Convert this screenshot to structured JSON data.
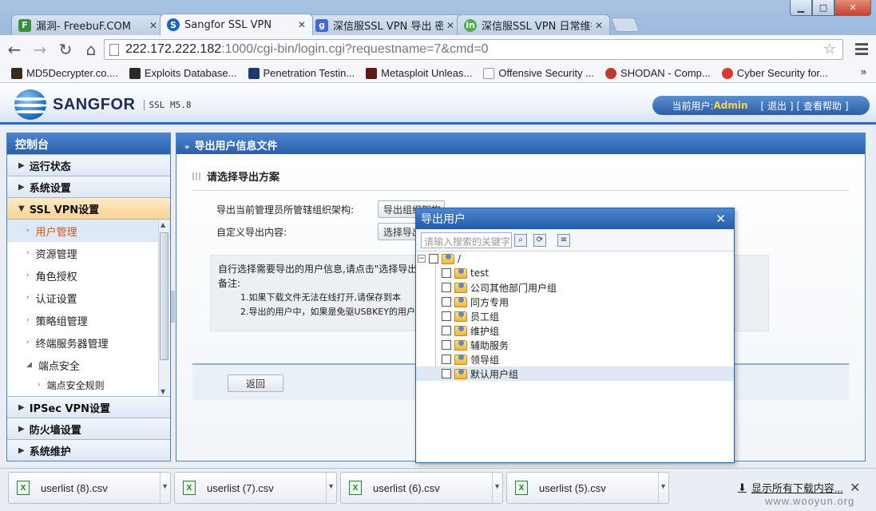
{
  "browser": {
    "tabs": [
      {
        "label": "漏洞- FreebuF.COM",
        "icon": "freebuf-icon",
        "color": "#3a8f3a",
        "glyph": "F"
      },
      {
        "label": "Sangfor SSL VPN",
        "icon": "sangfor-icon",
        "color": "#1a66b8",
        "glyph": "S"
      },
      {
        "label": "深信服SSL VPN 导出 密码",
        "icon": "google-icon",
        "color": "#3d6bd3",
        "glyph": "g"
      },
      {
        "label": "深信服SSL VPN 日常维护",
        "icon": "site-icon",
        "color": "#4caf50",
        "glyph": "in"
      }
    ],
    "url_host": "222.172.222.182",
    "url_rest": ":1000/cgi-bin/login.cgi?requestname=7&cmd=0",
    "bookmarks": [
      {
        "label": "MD5Decrypter.co....",
        "color": "#3b2a1a"
      },
      {
        "label": "Exploits Database...",
        "color": "#2a2a2a"
      },
      {
        "label": "Penetration Testin...",
        "color": "#1b3a6e"
      },
      {
        "label": "Metasploit Unleas...",
        "color": "#5a1a1a"
      },
      {
        "label": "Offensive Security ...",
        "color": "#dddddd"
      },
      {
        "label": "SHODAN - Comp...",
        "color": "#c0392b"
      },
      {
        "label": "Cyber Security for...",
        "color": "#d63b2f"
      }
    ],
    "bookmarks_more": "»"
  },
  "header": {
    "brand": "SANGFOR",
    "version": "SSL M5.8",
    "current_user_label": "当前用户:",
    "current_user": "Admin",
    "logout": "[ 退出 ]",
    "help": "[ 查看帮助 ]"
  },
  "sidebar": {
    "title": "控制台",
    "groups_top": [
      {
        "label": "运行状态"
      },
      {
        "label": "系统设置"
      }
    ],
    "open_group": "SSL VPN设置",
    "items": [
      {
        "label": "用户管理",
        "active": true
      },
      {
        "label": "资源管理"
      },
      {
        "label": "角色授权"
      },
      {
        "label": "认证设置"
      },
      {
        "label": "策略组管理"
      },
      {
        "label": "终端服务器管理"
      },
      {
        "label": "端点安全",
        "expanded": true
      }
    ],
    "child_items": [
      {
        "label": "端点安全规则"
      }
    ],
    "groups_bottom": [
      {
        "label": "IPSec VPN设置"
      },
      {
        "label": "防火墙设置"
      },
      {
        "label": "系统维护"
      }
    ]
  },
  "main": {
    "title": "导出用户信息文件",
    "section": "请选择导出方案",
    "row1_label": "导出当前管理员所管辖组织架构:",
    "row1_button": "导出组织架构",
    "row2_label": "自定义导出内容:",
    "row2_button": "选择导出",
    "info_line": "自行选择需要导出的用户信息,请点击\"选择导出",
    "note_label": "备注:",
    "note1": "1.如果下载文件无法在线打开,请保存到本",
    "note2": "2.导出的用户中，如果是免驱USBKEY的用户",
    "back_button": "返回"
  },
  "dialog": {
    "title": "导出用户",
    "close": "✕",
    "search_placeholder": "请输入搜索的关键字",
    "root": "/",
    "nodes": [
      {
        "label": "test"
      },
      {
        "label": "公司其他部门用户组"
      },
      {
        "label": "同方专用"
      },
      {
        "label": "员工组"
      },
      {
        "label": "维护组"
      },
      {
        "label": "辅助服务"
      },
      {
        "label": "领导组"
      },
      {
        "label": "默认用户组",
        "selected": true
      }
    ]
  },
  "downloads": {
    "items": [
      {
        "label": "userlist (8).csv"
      },
      {
        "label": "userlist (7).csv"
      },
      {
        "label": "userlist (6).csv"
      },
      {
        "label": "userlist (5).csv"
      }
    ],
    "show_all": "显示所有下载内容...",
    "close": "✕"
  },
  "watermark": "www.wooyun.org"
}
